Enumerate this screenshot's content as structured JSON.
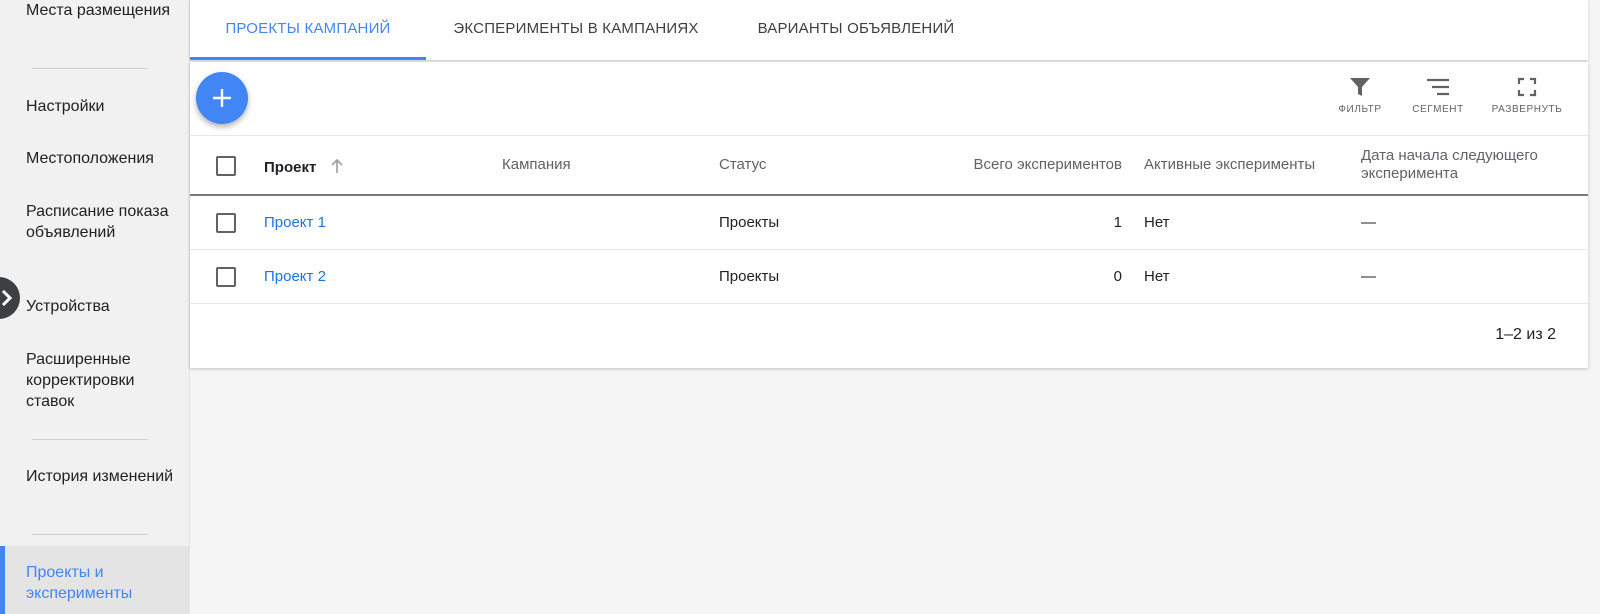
{
  "sidebar": {
    "items": [
      {
        "label": "Места размещения"
      },
      {
        "label": "Настройки"
      },
      {
        "label": "Местоположения"
      },
      {
        "label": "Расписание показа объявлений"
      },
      {
        "label": "Устройства"
      },
      {
        "label": "Расширенные корректировки ставок"
      },
      {
        "label": "История изменений"
      },
      {
        "label": "Проекты и эксперименты"
      }
    ]
  },
  "tabs": [
    {
      "label": "ПРОЕКТЫ КАМПАНИЙ"
    },
    {
      "label": "ЭКСПЕРИМЕНТЫ В КАМПАНИЯХ"
    },
    {
      "label": "ВАРИАНТЫ ОБЪЯВЛЕНИЙ"
    }
  ],
  "toolbar": {
    "filter_label": "ФИЛЬТР",
    "segment_label": "СЕГМЕНТ",
    "expand_label": "РАЗВЕРНУТЬ"
  },
  "table": {
    "columns": [
      "Проект",
      "Кампания",
      "Статус",
      "Всего экспериментов",
      "Активные эксперименты",
      "Дата начала следующего эксперимента"
    ],
    "rows": [
      {
        "project": "Проект 1",
        "campaign": "",
        "status": "Проекты",
        "total": "1",
        "active": "Нет",
        "next_date": "—"
      },
      {
        "project": "Проект 2",
        "campaign": "",
        "status": "Проекты",
        "total": "0",
        "active": "Нет",
        "next_date": "—"
      }
    ],
    "pagination": "1–2 из 2"
  },
  "colors": {
    "accent": "#4285f4",
    "link": "#1a73e8",
    "sidebar_bg": "#f1f1f1"
  }
}
